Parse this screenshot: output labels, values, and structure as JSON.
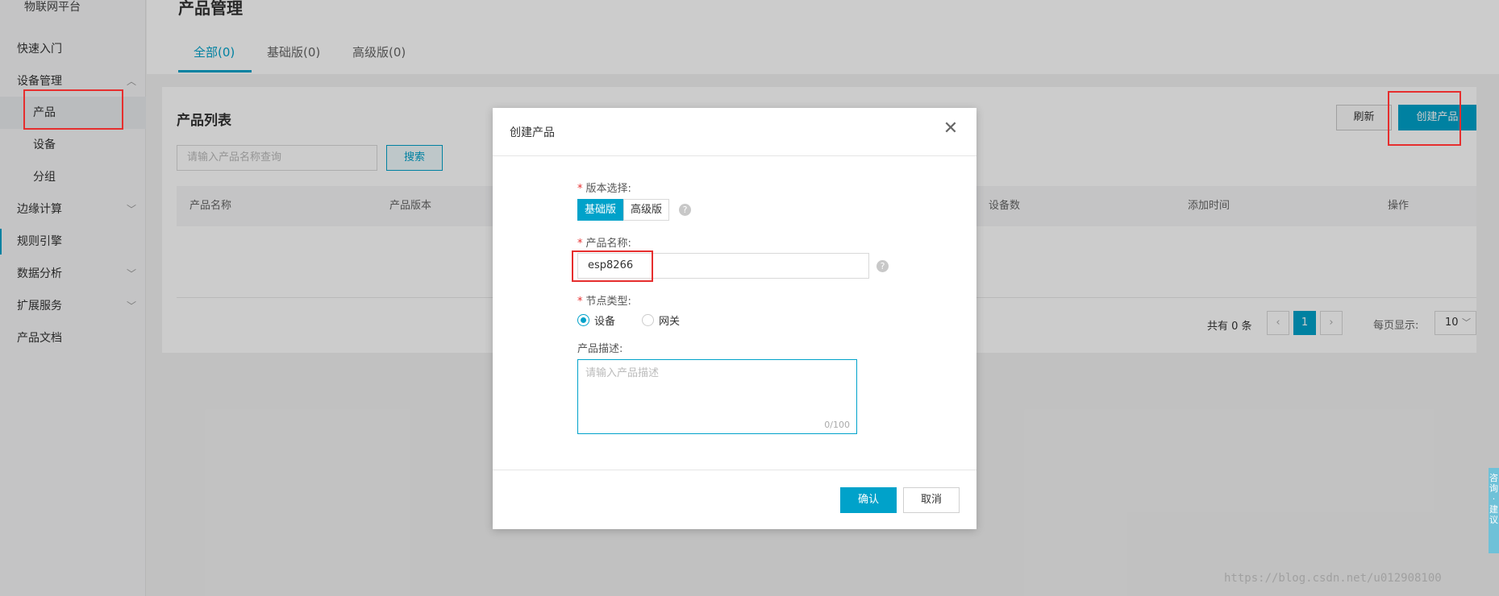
{
  "sidebar": {
    "title": "物联网平台",
    "items": [
      {
        "label": "快速入门"
      },
      {
        "label": "设备管理"
      },
      {
        "label": "产品"
      },
      {
        "label": "设备"
      },
      {
        "label": "分组"
      },
      {
        "label": "边缘计算"
      },
      {
        "label": "规则引擎"
      },
      {
        "label": "数据分析"
      },
      {
        "label": "扩展服务"
      },
      {
        "label": "产品文档"
      }
    ]
  },
  "header": {
    "title": "产品管理",
    "tabs": [
      {
        "label": "全部(0)"
      },
      {
        "label": "基础版(0)"
      },
      {
        "label": "高级版(0)"
      }
    ]
  },
  "list": {
    "title": "产品列表",
    "search_placeholder": "请输入产品名称查询",
    "search_label": "搜索",
    "refresh_label": "刷新",
    "create_label": "创建产品",
    "columns": [
      "产品名称",
      "产品版本",
      "设备数",
      "添加时间",
      "操作"
    ],
    "total_text": "共有 0 条",
    "current_page": "1",
    "per_page_label": "每页显示:",
    "per_page_value": "10"
  },
  "modal": {
    "title": "创建产品",
    "version_label": "版本选择:",
    "version_options": [
      "基础版",
      "高级版"
    ],
    "name_label": "产品名称:",
    "name_value": "esp8266",
    "node_label": "节点类型:",
    "node_options": [
      "设备",
      "网关"
    ],
    "desc_label": "产品描述:",
    "desc_placeholder": "请输入产品描述",
    "desc_count": "0/100",
    "confirm_label": "确认",
    "cancel_label": "取消"
  },
  "float_tab": "咨询·建议",
  "watermark": "https://blog.csdn.net/u012908100"
}
